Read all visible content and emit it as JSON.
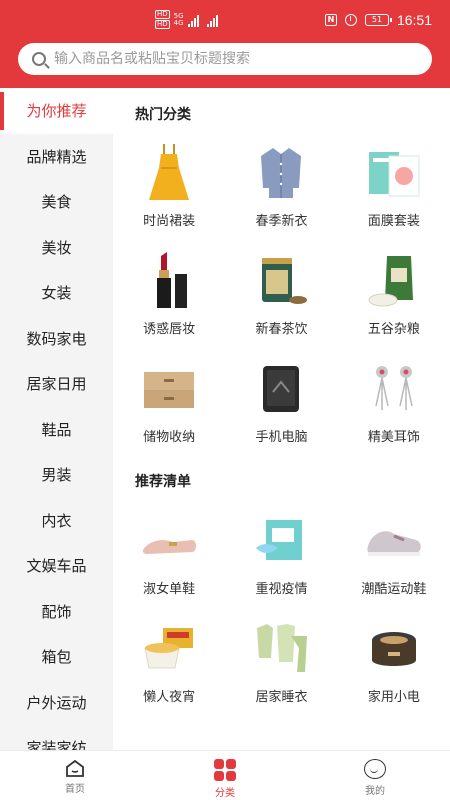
{
  "status_bar": {
    "network_tags": [
      "HD",
      "HD"
    ],
    "signal_labels": [
      "5G",
      "4G"
    ],
    "battery": "51",
    "time": "16:51"
  },
  "search": {
    "placeholder": "输入商品名或粘贴宝贝标题搜索"
  },
  "sidebar": {
    "items": [
      {
        "label": "为你推荐",
        "active": true
      },
      {
        "label": "品牌精选"
      },
      {
        "label": "美食"
      },
      {
        "label": "美妆"
      },
      {
        "label": "女装"
      },
      {
        "label": "数码家电"
      },
      {
        "label": "居家日用"
      },
      {
        "label": "鞋品"
      },
      {
        "label": "男装"
      },
      {
        "label": "内衣"
      },
      {
        "label": "文娱车品"
      },
      {
        "label": "配饰"
      },
      {
        "label": "箱包"
      },
      {
        "label": "户外运动"
      },
      {
        "label": "家装家纺"
      }
    ]
  },
  "sections": [
    {
      "title": "热门分类",
      "items": [
        {
          "label": "时尚裙装",
          "icon": "dress-icon"
        },
        {
          "label": "春季新衣",
          "icon": "shirt-icon"
        },
        {
          "label": "面膜套装",
          "icon": "face-mask-box-icon"
        },
        {
          "label": "诱惑唇妆",
          "icon": "lipstick-icon"
        },
        {
          "label": "新春茶饮",
          "icon": "tea-can-icon"
        },
        {
          "label": "五谷杂粮",
          "icon": "rice-bag-icon"
        },
        {
          "label": "储物收纳",
          "icon": "drawer-box-icon"
        },
        {
          "label": "手机电脑",
          "icon": "phone-icon"
        },
        {
          "label": "精美耳饰",
          "icon": "earrings-icon"
        }
      ]
    },
    {
      "title": "推荐清单",
      "items": [
        {
          "label": "淑女单鞋",
          "icon": "loafer-icon"
        },
        {
          "label": "重视疫情",
          "icon": "face-mask-icon"
        },
        {
          "label": "潮酷运动鞋",
          "icon": "sneaker-icon"
        },
        {
          "label": "懒人夜宵",
          "icon": "noodle-bowl-icon"
        },
        {
          "label": "居家睡衣",
          "icon": "pajamas-icon"
        },
        {
          "label": "家用小电",
          "icon": "rice-cooker-icon"
        }
      ]
    }
  ],
  "tabbar": {
    "tabs": [
      {
        "label": "首页",
        "icon": "home-icon"
      },
      {
        "label": "分类",
        "icon": "category-icon",
        "active": true
      },
      {
        "label": "我的",
        "icon": "profile-icon"
      }
    ]
  },
  "colors": {
    "accent": "#e4393c",
    "sidebar_bg": "#f4f4f4",
    "content_bg": "#ffffff"
  }
}
